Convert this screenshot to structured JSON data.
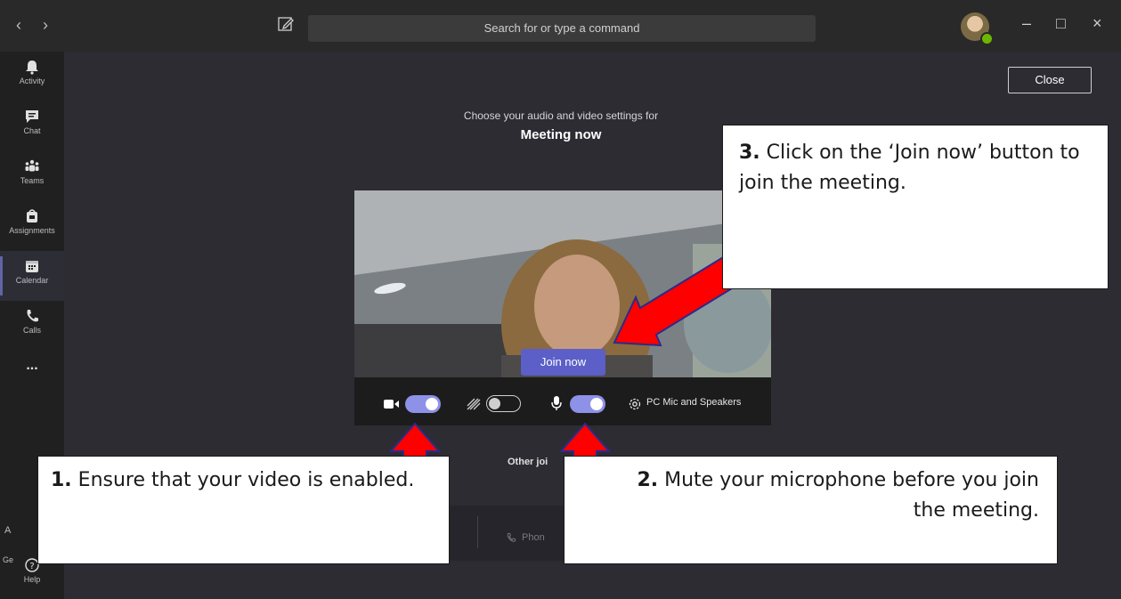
{
  "titlebar": {
    "back": "‹",
    "forward": "›",
    "search_placeholder": "Search for or type a command",
    "minimize": "–",
    "maximize": "□",
    "close": "×"
  },
  "rail": {
    "items": [
      {
        "label": "Activity",
        "icon": "bell-icon"
      },
      {
        "label": "Chat",
        "icon": "chat-icon"
      },
      {
        "label": "Teams",
        "icon": "teams-icon"
      },
      {
        "label": "Assignments",
        "icon": "assignments-icon"
      },
      {
        "label": "Calendar",
        "icon": "calendar-icon",
        "active": true
      },
      {
        "label": "Calls",
        "icon": "phone-icon"
      },
      {
        "label": "...",
        "icon": "more-icon"
      }
    ],
    "help_label": "Help",
    "partial_label_1": "Ge",
    "partial_label_2": "A"
  },
  "pre_join": {
    "close_label": "Close",
    "subtitle": "Choose your audio and video settings for",
    "meeting_title": "Meeting now",
    "join_label": "Join now",
    "camera_on": true,
    "background_blur_on": false,
    "mic_on": true,
    "audio_device_label": "PC Mic and Speakers",
    "other_options_label": "Other joi",
    "phone_label": "Phon"
  },
  "callouts": [
    {
      "number": "1.",
      "text": "Ensure that your video is enabled."
    },
    {
      "number": "2.",
      "text": "Mute your microphone before you join the meeting."
    },
    {
      "number": "3.",
      "text_before": "Click on the",
      "text_after": "‘Join now’ button to join the meeting."
    }
  ],
  "colors": {
    "accent": "#6264a7",
    "toggle_on": "#8e91e8",
    "arrow": "#ff0000",
    "presence": "#6bb700"
  }
}
